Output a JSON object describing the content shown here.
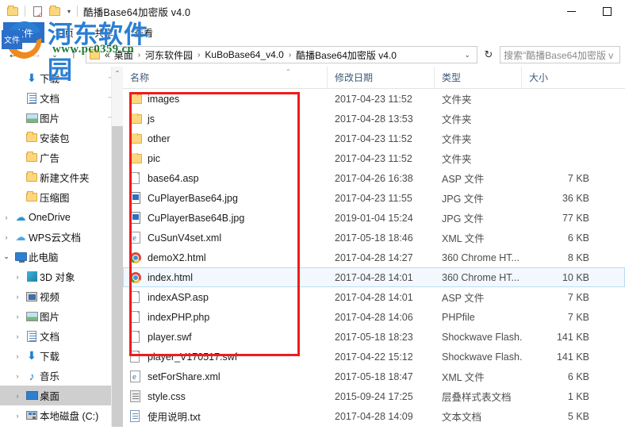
{
  "window": {
    "title": "酷播Base64加密版 v4.0",
    "quick_access": [
      "folder-icon",
      "properties-icon",
      "new-folder-icon"
    ],
    "caret": "▾",
    "controls": {
      "minimize": "—",
      "maximize": "☐"
    }
  },
  "ribbon": {
    "tabs": [
      {
        "label": "文件",
        "active": true
      },
      {
        "label": "主页",
        "active": false
      },
      {
        "label": "共享",
        "active": false
      },
      {
        "label": "查看",
        "active": false
      }
    ]
  },
  "address": {
    "back": "←",
    "forward": "→",
    "recent": "⌄",
    "up": "↑",
    "crumbs": [
      "«",
      "桌面",
      "河东软件园",
      "KuBoBase64_v4.0",
      "酷播Base64加密版 v4.0"
    ],
    "separator": "›",
    "dropdown": "⌄",
    "refresh": "↻",
    "search_placeholder": "搜索\"酷播Base64加密版 v"
  },
  "sidebar": {
    "items": [
      {
        "label": "下载",
        "icon": "download-icon",
        "chev": "",
        "pinned": true,
        "indent": 1
      },
      {
        "label": "文档",
        "icon": "document-icon",
        "chev": "",
        "pinned": true,
        "indent": 1
      },
      {
        "label": "图片",
        "icon": "pictures-icon",
        "chev": "",
        "pinned": true,
        "indent": 1
      },
      {
        "label": "安装包",
        "icon": "folder-icon",
        "chev": "",
        "pinned": false,
        "indent": 1
      },
      {
        "label": "广告",
        "icon": "folder-icon",
        "chev": "",
        "pinned": false,
        "indent": 1
      },
      {
        "label": "新建文件夹",
        "icon": "folder-icon",
        "chev": "",
        "pinned": false,
        "indent": 1
      },
      {
        "label": "压缩图",
        "icon": "folder-icon",
        "chev": "",
        "pinned": false,
        "indent": 1
      },
      {
        "label": "OneDrive",
        "icon": "onedrive-cloud-icon",
        "chev": "›",
        "pinned": false,
        "indent": 0
      },
      {
        "label": "WPS云文档",
        "icon": "wps-cloud-icon",
        "chev": "›",
        "pinned": false,
        "indent": 0
      },
      {
        "label": "此电脑",
        "icon": "this-pc-icon",
        "chev": "⌄",
        "pinned": false,
        "indent": 0
      },
      {
        "label": "3D 对象",
        "icon": "3d-objects-icon",
        "chev": "›",
        "pinned": false,
        "indent": 1
      },
      {
        "label": "视频",
        "icon": "videos-icon",
        "chev": "›",
        "pinned": false,
        "indent": 1
      },
      {
        "label": "图片",
        "icon": "pictures-icon",
        "chev": "›",
        "pinned": false,
        "indent": 1
      },
      {
        "label": "文档",
        "icon": "document-icon",
        "chev": "›",
        "pinned": false,
        "indent": 1
      },
      {
        "label": "下载",
        "icon": "download-icon",
        "chev": "›",
        "pinned": false,
        "indent": 1
      },
      {
        "label": "音乐",
        "icon": "music-icon",
        "chev": "›",
        "pinned": false,
        "indent": 1
      },
      {
        "label": "桌面",
        "icon": "desktop-icon",
        "chev": "›",
        "pinned": false,
        "indent": 1,
        "selected": true
      },
      {
        "label": "本地磁盘 (C:)",
        "icon": "local-disk-icon",
        "chev": "›",
        "pinned": false,
        "indent": 1
      }
    ],
    "scroll_up_arrow": "⌃"
  },
  "filelist": {
    "columns": [
      {
        "label": "名称",
        "key": "name"
      },
      {
        "label": "修改日期",
        "key": "date"
      },
      {
        "label": "类型",
        "key": "type"
      },
      {
        "label": "大小",
        "key": "size"
      }
    ],
    "sort_indicator": "⌃",
    "rows": [
      {
        "name": "images",
        "date": "2017-04-23 11:52",
        "type": "文件夹",
        "size": "",
        "icon": "folder-icon",
        "selected": false
      },
      {
        "name": "js",
        "date": "2017-04-28 13:53",
        "type": "文件夹",
        "size": "",
        "icon": "folder-icon",
        "selected": false
      },
      {
        "name": "other",
        "date": "2017-04-23 11:52",
        "type": "文件夹",
        "size": "",
        "icon": "folder-icon",
        "selected": false
      },
      {
        "name": "pic",
        "date": "2017-04-23 11:52",
        "type": "文件夹",
        "size": "",
        "icon": "folder-icon",
        "selected": false
      },
      {
        "name": "base64.asp",
        "date": "2017-04-26 16:38",
        "type": "ASP 文件",
        "size": "7 KB",
        "icon": "blank-file-icon",
        "selected": false
      },
      {
        "name": "CuPlayerBase64.jpg",
        "date": "2017-04-23 11:55",
        "type": "JPG 文件",
        "size": "36 KB",
        "icon": "jpg-file-icon",
        "selected": false
      },
      {
        "name": "CuPlayerBase64B.jpg",
        "date": "2019-01-04 15:24",
        "type": "JPG 文件",
        "size": "77 KB",
        "icon": "jpg-file-icon",
        "selected": false
      },
      {
        "name": "CuSunV4set.xml",
        "date": "2017-05-18 18:46",
        "type": "XML 文件",
        "size": "6 KB",
        "icon": "xml-file-icon",
        "selected": false
      },
      {
        "name": "demoX2.html",
        "date": "2017-04-28 14:27",
        "type": "360 Chrome HT...",
        "size": "8 KB",
        "icon": "chrome-html-icon",
        "selected": false
      },
      {
        "name": "index.html",
        "date": "2017-04-28 14:01",
        "type": "360 Chrome HT...",
        "size": "10 KB",
        "icon": "chrome-html-icon",
        "selected": true
      },
      {
        "name": "indexASP.asp",
        "date": "2017-04-28 14:01",
        "type": "ASP 文件",
        "size": "7 KB",
        "icon": "blank-file-icon",
        "selected": false
      },
      {
        "name": "indexPHP.php",
        "date": "2017-04-28 14:06",
        "type": "PHPfile",
        "size": "7 KB",
        "icon": "blank-file-icon",
        "selected": false
      },
      {
        "name": "player.swf",
        "date": "2017-05-18 18:23",
        "type": "Shockwave Flash...",
        "size": "141 KB",
        "icon": "blank-file-icon",
        "selected": false
      },
      {
        "name": "player_V170517.swf",
        "date": "2017-04-22 15:12",
        "type": "Shockwave Flash...",
        "size": "141 KB",
        "icon": "blank-file-icon",
        "selected": false
      },
      {
        "name": "setForShare.xml",
        "date": "2017-05-18 18:47",
        "type": "XML 文件",
        "size": "6 KB",
        "icon": "xml-file-icon",
        "selected": false
      },
      {
        "name": "style.css",
        "date": "2015-09-24 17:25",
        "type": "层叠样式表文档",
        "size": "1 KB",
        "icon": "css-file-icon",
        "selected": false
      },
      {
        "name": "使用说明.txt",
        "date": "2017-04-28 14:09",
        "type": "文本文档",
        "size": "5 KB",
        "icon": "txt-file-icon",
        "selected": false
      }
    ]
  },
  "annotation": {
    "color": "#ee1c1c",
    "shape": "rectangle"
  },
  "watermark": {
    "site_name": "河东软件园",
    "url": "www.pc0359.cn",
    "logo_text": "文件",
    "brand_blue": "#2a7fd4",
    "brand_green": "#1f7a33",
    "brand_orange": "#f08a1c"
  }
}
